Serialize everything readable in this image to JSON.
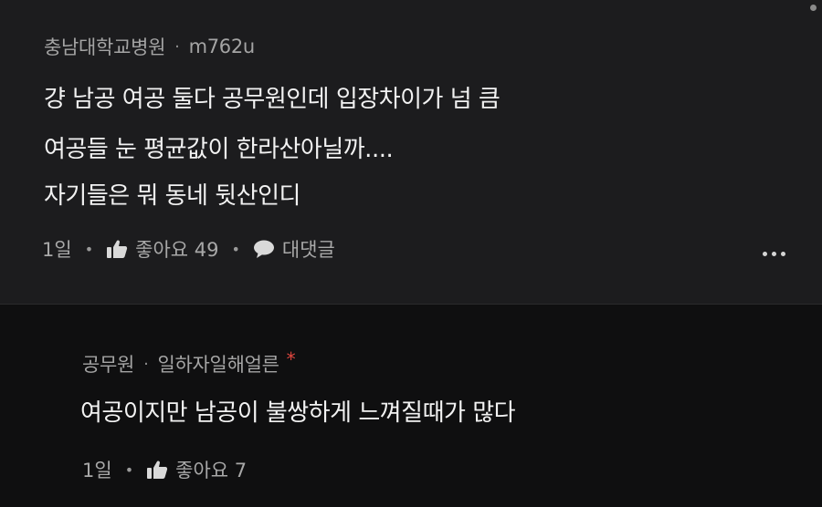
{
  "comment": {
    "author": "충남대학교병원",
    "separator": "·",
    "nickname": "m762u",
    "lines": [
      "걍 남공 여공 둘다 공무원인데 입장차이가 넘 큼",
      "여공들 눈 평균값이 한라산아닐까....",
      "자기들은 뭐 동네 뒷산인디"
    ],
    "time": "1일",
    "like_label": "좋아요 49",
    "reply_label": "대댓글",
    "icons": [
      "thumbs-up-icon",
      "speech-bubble-icon",
      "more-horizontal-icon"
    ]
  },
  "reply": {
    "author": "공무원",
    "separator": "·",
    "nickname": "일하자일해얼른",
    "marker": "*",
    "lines": [
      "여공이지만 남공이 불쌍하게 느껴질때가 많다"
    ],
    "time": "1일",
    "like_label": "좋아요 7",
    "icons": [
      "thumbs-up-icon"
    ]
  },
  "colors": {
    "background": "#0f0f10",
    "comment_background": "#1c1c1e",
    "text": "#f2f2f2",
    "meta": "#a4a4a4",
    "marker": "#e0473f"
  }
}
